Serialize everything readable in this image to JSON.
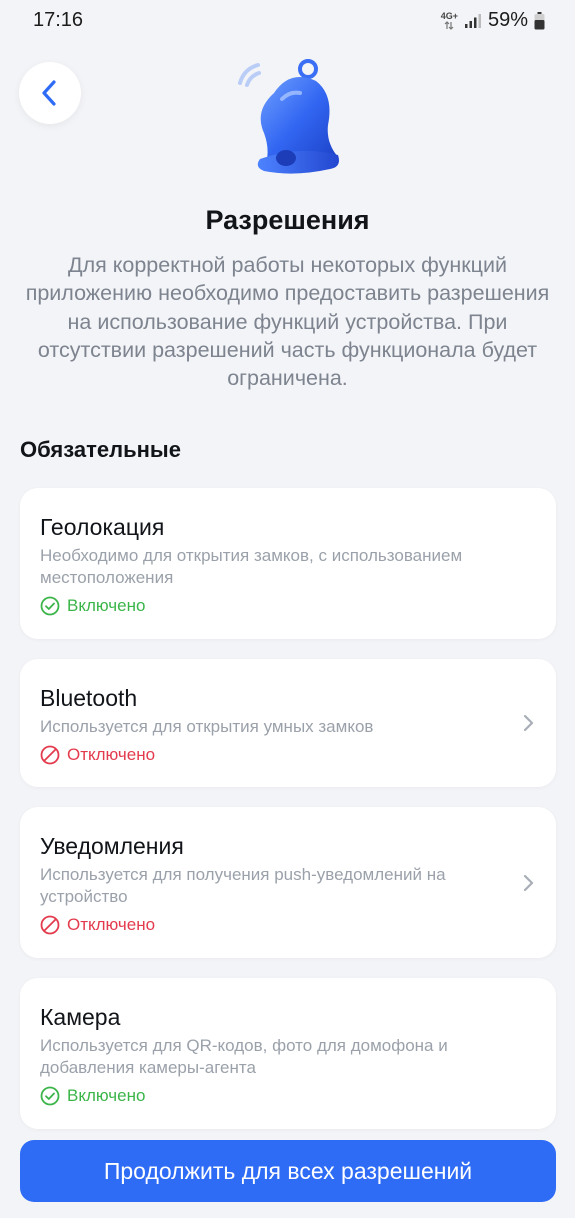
{
  "status_bar": {
    "time": "17:16",
    "network_label": "4G+",
    "battery_percent": "59%",
    "icons": [
      "network-arrows-icon",
      "signal-icon",
      "battery-icon"
    ]
  },
  "header": {
    "back_icon": "chevron-left-icon",
    "illustration": "bell-icon",
    "title": "Разрешения",
    "description": "Для корректной работы некоторых функций приложению необходимо предоставить разрешения на использование функций устройства. При отсутствии разрешений часть функционала будет ограничена."
  },
  "section": {
    "title": "Обязательные"
  },
  "permissions": [
    {
      "title": "Геолокация",
      "description": "Необходимо для открытия замков, с использованием местоположения",
      "status": "Включено",
      "enabled": true
    },
    {
      "title": "Bluetooth",
      "description": "Используется для открытия умных замков",
      "status": "Отключено",
      "enabled": false
    },
    {
      "title": "Уведомления",
      "description": "Используется для получения push-уведомлений на устройство",
      "status": "Отключено",
      "enabled": false
    },
    {
      "title": "Камера",
      "description": "Используется для QR-кодов, фото для домофона и добавления камеры-агента",
      "status": "Включено",
      "enabled": true
    }
  ],
  "footer": {
    "continue_label": "Продолжить для всех разрешений"
  },
  "colors": {
    "accent": "#2f6cf6",
    "enabled": "#3bb54a",
    "disabled": "#e33b4d",
    "background": "#f3f4f7"
  }
}
